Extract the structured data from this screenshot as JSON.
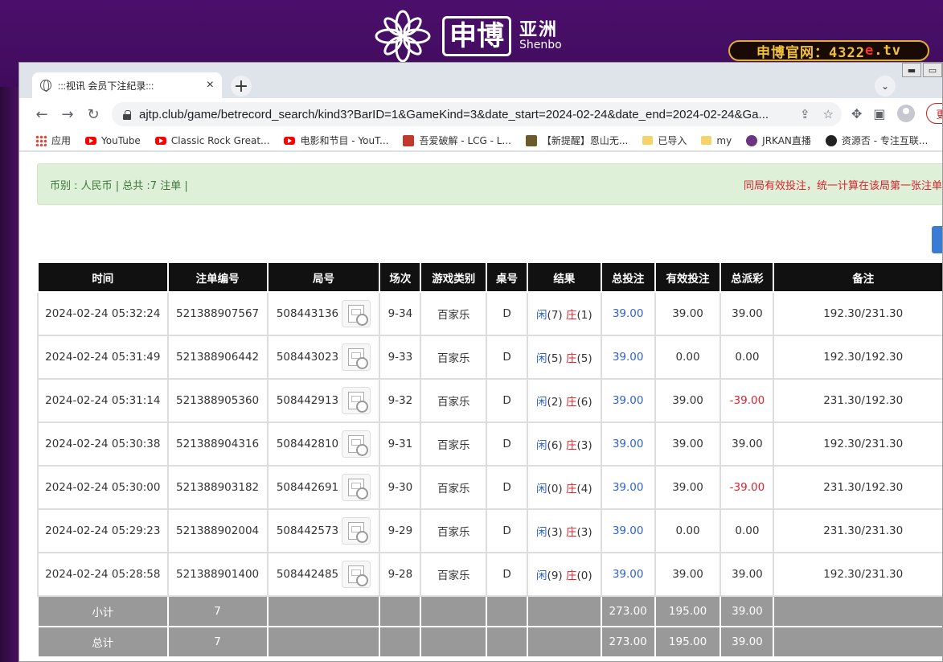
{
  "background": {
    "logo_cn": "申博",
    "logo_side_cn": "亚洲",
    "logo_side_en": "Shenbo",
    "official_prefix": "申博官网：4322",
    "official_e": "e",
    "official_suffix": ".tv"
  },
  "tab": {
    "title": ":::视讯 会员下注纪录:::",
    "close": "×"
  },
  "new_tab_label": "+",
  "tab_search_label": "⌄",
  "toolbar": {
    "back": "←",
    "forward": "→",
    "reload": "↻",
    "url": "ajtp.club/game/betrecord_search/kind3?BarID=1&GameKind=3&date_start=2024-02-24&date_end=2024-02-24&Ga...",
    "update_label": "更"
  },
  "bookmarks": [
    {
      "label": "应用",
      "icon": "apps-icon",
      "cls": "ic-apps"
    },
    {
      "label": "YouTube",
      "icon": "youtube-icon",
      "cls": "ic-yt"
    },
    {
      "label": "Classic Rock Great...",
      "icon": "youtube-icon",
      "cls": "ic-yt"
    },
    {
      "label": "电影和节目 - YouT...",
      "icon": "youtube-icon",
      "cls": "ic-yt"
    },
    {
      "label": "吾爱破解 - LCG - L...",
      "icon": "lcg-icon",
      "cls": "ic-lcg"
    },
    {
      "label": "【新提醒】恩山无...",
      "icon": "image-icon",
      "cls": "ic-img"
    },
    {
      "label": "已导入",
      "icon": "folder-icon",
      "cls": "ic-folder"
    },
    {
      "label": "my",
      "icon": "folder-icon",
      "cls": "ic-folder"
    },
    {
      "label": "JRKAN直播",
      "icon": "jrkan-icon",
      "cls": "ic-purple"
    },
    {
      "label": "资源否 - 专注互联...",
      "icon": "resource-icon",
      "cls": "ic-dark"
    }
  ],
  "info": {
    "left": "币别 : 人民币 | 总共 :7 注单 |",
    "right": "同局有效投注，统一计算在该局第一张注单内"
  },
  "table": {
    "headers": [
      "时间",
      "注单编号",
      "局号",
      "场次",
      "游戏类别",
      "桌号",
      "结果",
      "总投注",
      "有效投注",
      "总派彩",
      "备注"
    ],
    "rows": [
      {
        "time": "2024-02-24 05:32:24",
        "bet_id": "521388907567",
        "round": "508443136",
        "session": "9-34",
        "game": "百家乐",
        "table": "D",
        "player_label": "闲",
        "player_val": "(7)",
        "banker_label": "庄",
        "banker_val": "(1)",
        "total": "39.00",
        "valid": "39.00",
        "payout": "39.00",
        "payout_negative": false,
        "note": "192.30/231.30"
      },
      {
        "time": "2024-02-24 05:31:49",
        "bet_id": "521388906442",
        "round": "508443023",
        "session": "9-33",
        "game": "百家乐",
        "table": "D",
        "player_label": "闲",
        "player_val": "(5)",
        "banker_label": "庄",
        "banker_val": "(5)",
        "total": "39.00",
        "valid": "0.00",
        "payout": "0.00",
        "payout_negative": false,
        "note": "192.30/192.30"
      },
      {
        "time": "2024-02-24 05:31:14",
        "bet_id": "521388905360",
        "round": "508442913",
        "session": "9-32",
        "game": "百家乐",
        "table": "D",
        "player_label": "闲",
        "player_val": "(2)",
        "banker_label": "庄",
        "banker_val": "(6)",
        "total": "39.00",
        "valid": "39.00",
        "payout": "-39.00",
        "payout_negative": true,
        "note": "231.30/192.30"
      },
      {
        "time": "2024-02-24 05:30:38",
        "bet_id": "521388904316",
        "round": "508442810",
        "session": "9-31",
        "game": "百家乐",
        "table": "D",
        "player_label": "闲",
        "player_val": "(6)",
        "banker_label": "庄",
        "banker_val": "(3)",
        "total": "39.00",
        "valid": "39.00",
        "payout": "39.00",
        "payout_negative": false,
        "note": "192.30/231.30"
      },
      {
        "time": "2024-02-24 05:30:00",
        "bet_id": "521388903182",
        "round": "508442691",
        "session": "9-30",
        "game": "百家乐",
        "table": "D",
        "player_label": "闲",
        "player_val": "(0)",
        "banker_label": "庄",
        "banker_val": "(4)",
        "total": "39.00",
        "valid": "39.00",
        "payout": "-39.00",
        "payout_negative": true,
        "note": "231.30/192.30"
      },
      {
        "time": "2024-02-24 05:29:23",
        "bet_id": "521388902004",
        "round": "508442573",
        "session": "9-29",
        "game": "百家乐",
        "table": "D",
        "player_label": "闲",
        "player_val": "(3)",
        "banker_label": "庄",
        "banker_val": "(3)",
        "total": "39.00",
        "valid": "0.00",
        "payout": "0.00",
        "payout_negative": false,
        "note": "231.30/231.30"
      },
      {
        "time": "2024-02-24 05:28:58",
        "bet_id": "521388901400",
        "round": "508442485",
        "session": "9-28",
        "game": "百家乐",
        "table": "D",
        "player_label": "闲",
        "player_val": "(9)",
        "banker_label": "庄",
        "banker_val": "(0)",
        "total": "39.00",
        "valid": "39.00",
        "payout": "39.00",
        "payout_negative": false,
        "note": "192.30/231.30"
      }
    ],
    "summary": [
      {
        "label": "小计",
        "count": "7",
        "total": "273.00",
        "valid": "195.00",
        "payout": "39.00"
      },
      {
        "label": "总计",
        "count": "7",
        "total": "273.00",
        "valid": "195.00",
        "payout": "39.00"
      }
    ]
  }
}
